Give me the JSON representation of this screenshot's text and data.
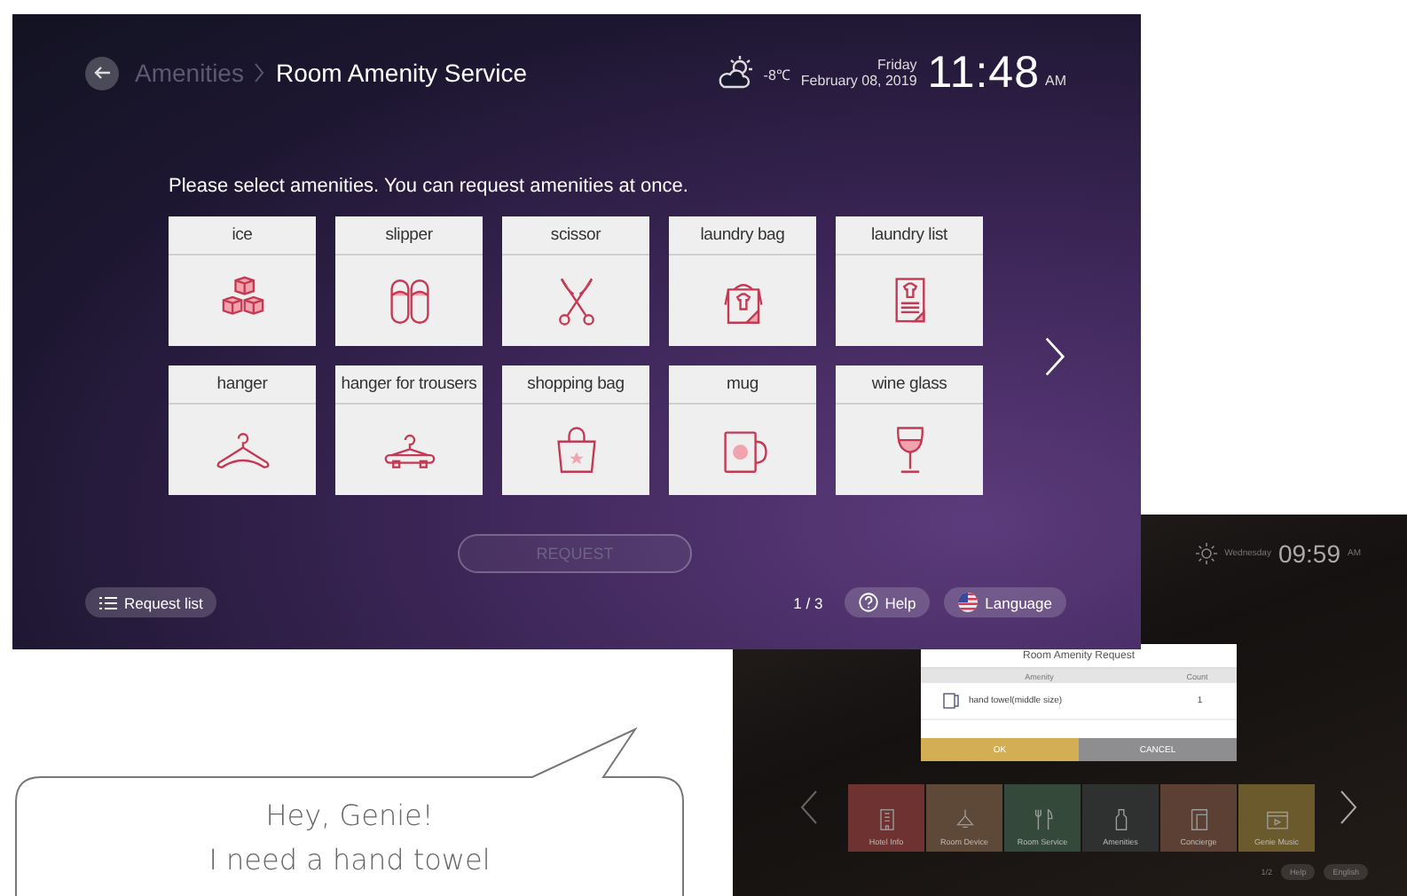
{
  "main_screen": {
    "breadcrumb": {
      "parent": "Amenities",
      "current": "Room Amenity Service"
    },
    "weather": {
      "temperature": "-8℃"
    },
    "date": {
      "weekday": "Friday",
      "date": "February 08, 2019"
    },
    "clock": {
      "time": "11:48",
      "meridiem": "AM"
    },
    "instruction": "Please select amenities. You can request amenities at once.",
    "amenities": [
      {
        "label": "ice"
      },
      {
        "label": "slipper"
      },
      {
        "label": "scissor"
      },
      {
        "label": "laundry bag"
      },
      {
        "label": "laundry list"
      },
      {
        "label": "hanger"
      },
      {
        "label": "hanger for trousers"
      },
      {
        "label": "shopping bag"
      },
      {
        "label": "mug"
      },
      {
        "label": "wine glass"
      }
    ],
    "request_button": {
      "label": "REQUEST",
      "disabled": true
    },
    "request_list": "Request list",
    "page": "1 / 3",
    "help": "Help",
    "language": "Language"
  },
  "speech_bubble": {
    "lines": [
      "Hey, Genie!",
      "I need a hand towel"
    ]
  },
  "tv_screen": {
    "clock": {
      "weekday": "Wednesday",
      "time": "09:59",
      "meridiem": "AM"
    },
    "dialog": {
      "title": "Room Amenity Request",
      "columns": [
        "Amenity",
        "Count"
      ],
      "rows": [
        {
          "amenity": "hand towel(middle size)",
          "count": "1"
        }
      ],
      "buttons": [
        {
          "label": "OK",
          "kind": "confirm"
        },
        {
          "label": "CANCEL",
          "kind": "cancel"
        }
      ]
    },
    "menu": [
      {
        "label": "Hotel Info",
        "color": "#6e3230"
      },
      {
        "label": "Room Device",
        "color": "#5e4838"
      },
      {
        "label": "Room Service",
        "color": "#34493a"
      },
      {
        "label": "Amenities",
        "color": "#2f3030"
      },
      {
        "label": "Concierge",
        "color": "#5c4034"
      },
      {
        "label": "Genie Music",
        "color": "#6a5a2c"
      }
    ],
    "page": "1/2",
    "help": "Help",
    "language": "English"
  }
}
